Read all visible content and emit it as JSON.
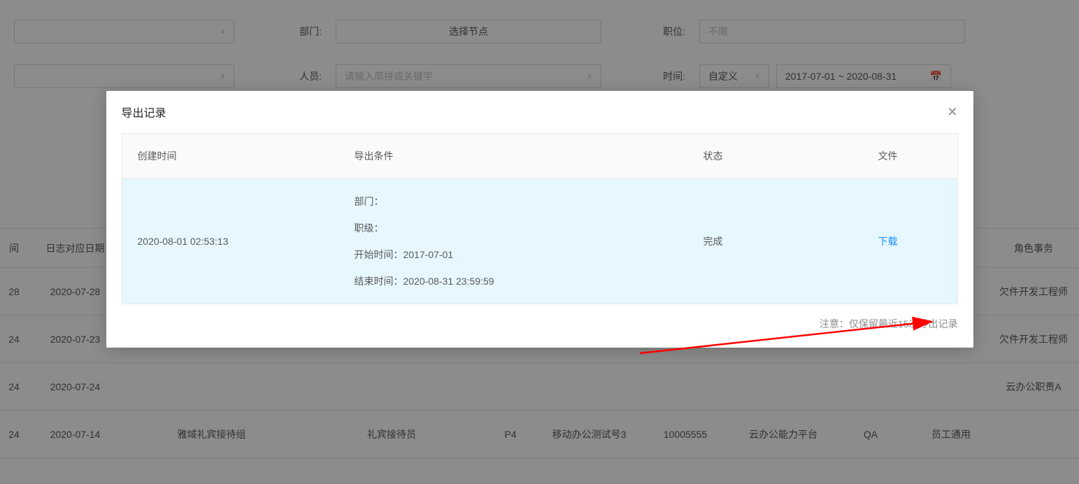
{
  "bg": {
    "filters": {
      "dept_label": "部门:",
      "dept_placeholder": "选择节点",
      "position_label": "职位:",
      "position_placeholder": "不限",
      "person_label": "人员:",
      "person_placeholder": "请输入简拼或关键字",
      "time_label": "时间:",
      "time_mode": "自定义",
      "time_range": "2017-07-01 ~ 2020-08-31"
    },
    "table": {
      "headers": {
        "c0": "间",
        "c1": "日志对应日期",
        "c8": "角色事务"
      },
      "rows": [
        {
          "c0": "28",
          "c1": "2020-07-28",
          "c8": "欠件开发工程师"
        },
        {
          "c0": "24",
          "c1": "2020-07-23",
          "c8": "欠件开发工程师"
        },
        {
          "c0": "24",
          "c1": "2020-07-24",
          "c8": "云办公职责A"
        },
        {
          "c0": "24",
          "c1": "2020-07-14",
          "c2": "雅域礼宾接待组",
          "c3": "礼宾接待员",
          "c4": "P4",
          "c5": "移动办公测试号3",
          "c6": "10005555",
          "c7": "云办公能力平台",
          "c7b": "QA",
          "c8": "员工通用"
        }
      ]
    }
  },
  "modal": {
    "title": "导出记录",
    "close_aria": "关闭",
    "columns": {
      "create_time": "创建时间",
      "conditions": "导出条件",
      "status": "状态",
      "file": "文件"
    },
    "row1": {
      "create_time": "2020-08-01 02:53:13",
      "cond_dept": "部门：",
      "cond_level": "职级：",
      "cond_start": "开始时间：2017-07-01",
      "cond_end": "结束时间：2020-08-31 23:59:59",
      "status": "完成",
      "download": "下载"
    },
    "footer_note": "注意：仅保留最近15次导出记录"
  }
}
